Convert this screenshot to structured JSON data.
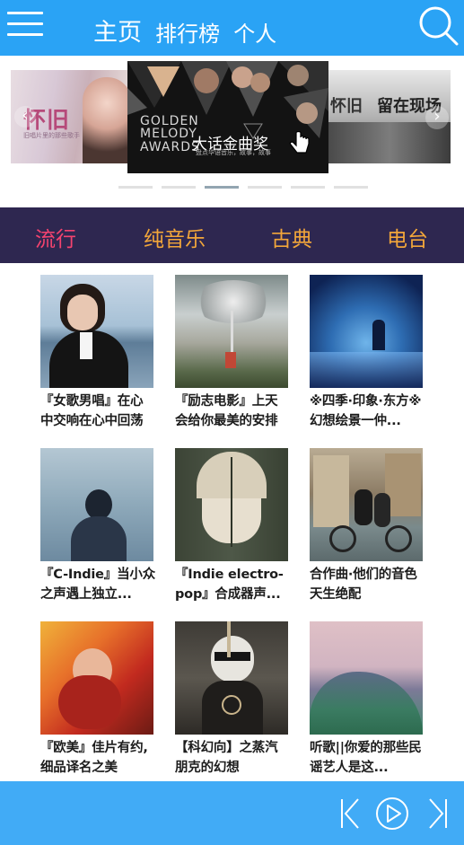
{
  "header": {
    "home": "主页",
    "ranking": "排行榜",
    "personal": "个人",
    "bg_color": "#2aa3f5",
    "menu_icon": "menu-icon",
    "search_icon": "search-icon"
  },
  "carousel": {
    "slide_left_title": "怀旧",
    "slide_left_sub": "旧唱片里的那些歌手",
    "slide_main_en": [
      "GOLDEN",
      "MELODY",
      "AWARDS"
    ],
    "slide_main_cn": "大话金曲奖",
    "slide_main_sub": "盘点华语音乐，故事，故事",
    "slide_right_t1": "怀旧",
    "slide_right_t2": "留在现场",
    "prev_icon": "‹",
    "next_icon": "›",
    "dot_count": 6,
    "active_dot": 3
  },
  "categories": [
    {
      "label": "流行",
      "active": true
    },
    {
      "label": "纯音乐",
      "active": false
    },
    {
      "label": "古典",
      "active": false
    },
    {
      "label": "电台",
      "active": false
    }
  ],
  "playlists": [
    {
      "title": "『女歌男唱』在心中交响在心中回荡"
    },
    {
      "title": "『励志电影』上天会给你最美的安排"
    },
    {
      "title": "※四季·印象·东方※幻想绘景一仲..."
    },
    {
      "title": "『C-Indie』当小众之声遇上独立..."
    },
    {
      "title": "『Indie electro-pop』合成器声..."
    },
    {
      "title": "合作曲·他们的音色天生绝配"
    },
    {
      "title": "『欧美』佳片有约, 细品译名之美"
    },
    {
      "title": "【科幻向】之蒸汽朋克的幻想"
    },
    {
      "title": "听歌||你爱的那些民谣艺人是这..."
    }
  ],
  "player": {
    "bg_color": "#41abf6",
    "prev_icon": "skip-back-icon",
    "play_icon": "play-icon",
    "next_icon": "skip-forward-icon"
  },
  "colors": {
    "accent": "#2aa3f5",
    "category_bg": "#2e2750",
    "category_active": "#f4436f",
    "category_normal": "#f2a63a"
  }
}
